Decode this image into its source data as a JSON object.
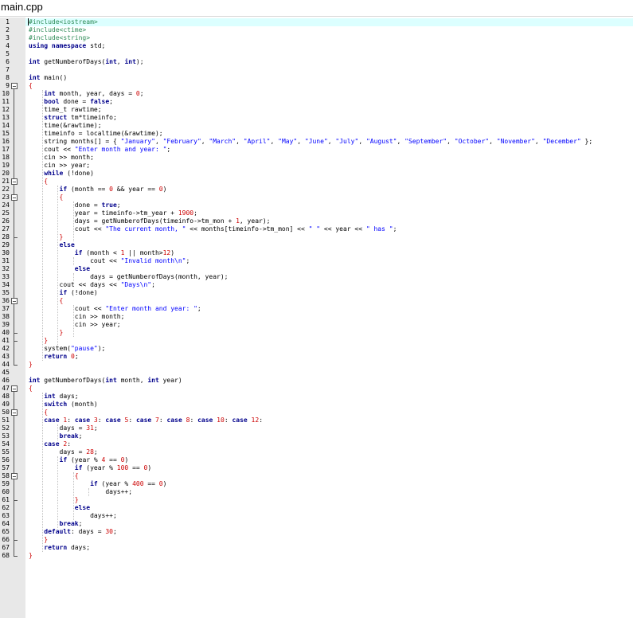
{
  "window": {
    "title": "main.cpp"
  },
  "colors": {
    "keyword": "#00008b",
    "string": "#0000ff",
    "number": "#cc0000",
    "preprocessor": "#2e8b57",
    "brace": "#cc0000",
    "plain": "#000000",
    "current_line": "#dcffff"
  },
  "editor": {
    "current_line": 1,
    "lines": [
      {
        "n": "1",
        "t": [
          [
            "pp",
            "#include<iostream>"
          ]
        ]
      },
      {
        "n": "2",
        "t": [
          [
            "pp",
            "#include<ctime>"
          ]
        ]
      },
      {
        "n": "3",
        "t": [
          [
            "pp",
            "#include<string>"
          ]
        ]
      },
      {
        "n": "4",
        "t": [
          [
            "kw",
            "using namespace"
          ],
          [
            "p",
            " std;"
          ]
        ]
      },
      {
        "n": "5",
        "t": []
      },
      {
        "n": "6",
        "t": [
          [
            "kw",
            "int"
          ],
          [
            "p",
            " getNumberofDays("
          ],
          [
            "kw",
            "int"
          ],
          [
            "p",
            ", "
          ],
          [
            "kw",
            "int"
          ],
          [
            "p",
            ");"
          ]
        ]
      },
      {
        "n": "7",
        "t": []
      },
      {
        "n": "8",
        "t": [
          [
            "kw",
            "int"
          ],
          [
            "p",
            " main()"
          ]
        ]
      },
      {
        "n": "9",
        "t": [
          [
            "br",
            "{"
          ]
        ]
      },
      {
        "n": "10",
        "t": [
          [
            "p",
            "    "
          ],
          [
            "kw",
            "int"
          ],
          [
            "p",
            " month, year, days = "
          ],
          [
            "num",
            "0"
          ],
          [
            "p",
            ";"
          ]
        ]
      },
      {
        "n": "11",
        "t": [
          [
            "p",
            "    "
          ],
          [
            "kw",
            "bool"
          ],
          [
            "p",
            " done = "
          ],
          [
            "kw",
            "false"
          ],
          [
            "p",
            ";"
          ]
        ]
      },
      {
        "n": "12",
        "t": [
          [
            "p",
            "    time_t rawtime;"
          ]
        ]
      },
      {
        "n": "13",
        "t": [
          [
            "p",
            "    "
          ],
          [
            "kw",
            "struct"
          ],
          [
            "p",
            " tm*timeinfo;"
          ]
        ]
      },
      {
        "n": "14",
        "t": [
          [
            "p",
            "    time(&rawtime);"
          ]
        ]
      },
      {
        "n": "15",
        "t": [
          [
            "p",
            "    timeinfo = localtime(&rawtime);"
          ]
        ]
      },
      {
        "n": "16",
        "t": [
          [
            "p",
            "    string months[] = { "
          ],
          [
            "str",
            "\"January\""
          ],
          [
            "p",
            ", "
          ],
          [
            "str",
            "\"February\""
          ],
          [
            "p",
            ", "
          ],
          [
            "str",
            "\"March\""
          ],
          [
            "p",
            ", "
          ],
          [
            "str",
            "\"April\""
          ],
          [
            "p",
            ", "
          ],
          [
            "str",
            "\"May\""
          ],
          [
            "p",
            ", "
          ],
          [
            "str",
            "\"June\""
          ],
          [
            "p",
            ", "
          ],
          [
            "str",
            "\"July\""
          ],
          [
            "p",
            ", "
          ],
          [
            "str",
            "\"August\""
          ],
          [
            "p",
            ", "
          ],
          [
            "str",
            "\"September\""
          ],
          [
            "p",
            ", "
          ],
          [
            "str",
            "\"October\""
          ],
          [
            "p",
            ", "
          ],
          [
            "str",
            "\"November\""
          ],
          [
            "p",
            ", "
          ],
          [
            "str",
            "\"December\""
          ],
          [
            "p",
            " };"
          ]
        ]
      },
      {
        "n": "17",
        "t": [
          [
            "p",
            "    cout << "
          ],
          [
            "str",
            "\"Enter month and year: \""
          ],
          [
            "p",
            ";"
          ]
        ]
      },
      {
        "n": "18",
        "t": [
          [
            "p",
            "    cin >> month;"
          ]
        ]
      },
      {
        "n": "19",
        "t": [
          [
            "p",
            "    cin >> year;"
          ]
        ]
      },
      {
        "n": "20",
        "t": [
          [
            "p",
            "    "
          ],
          [
            "kw",
            "while"
          ],
          [
            "p",
            " (!done)"
          ]
        ]
      },
      {
        "n": "21",
        "t": [
          [
            "p",
            "    "
          ],
          [
            "br",
            "{"
          ]
        ]
      },
      {
        "n": "22",
        "t": [
          [
            "p",
            "        "
          ],
          [
            "kw",
            "if"
          ],
          [
            "p",
            " (month == "
          ],
          [
            "num",
            "0"
          ],
          [
            "p",
            " && year == "
          ],
          [
            "num",
            "0"
          ],
          [
            "p",
            ")"
          ]
        ]
      },
      {
        "n": "23",
        "t": [
          [
            "p",
            "        "
          ],
          [
            "br",
            "{"
          ]
        ]
      },
      {
        "n": "24",
        "t": [
          [
            "p",
            "            done = "
          ],
          [
            "kw",
            "true"
          ],
          [
            "p",
            ";"
          ]
        ]
      },
      {
        "n": "25",
        "t": [
          [
            "p",
            "            year = timeinfo->tm_year + "
          ],
          [
            "num",
            "1900"
          ],
          [
            "p",
            ";"
          ]
        ]
      },
      {
        "n": "26",
        "t": [
          [
            "p",
            "            days = getNumberofDays(timeinfo->tm_mon + "
          ],
          [
            "num",
            "1"
          ],
          [
            "p",
            ", year);"
          ]
        ]
      },
      {
        "n": "27",
        "t": [
          [
            "p",
            "            cout << "
          ],
          [
            "str",
            "\"The current month, \""
          ],
          [
            "p",
            " << months[timeinfo->tm_mon] << "
          ],
          [
            "str",
            "\" \""
          ],
          [
            "p",
            " << year << "
          ],
          [
            "str",
            "\" has \""
          ],
          [
            "p",
            ";"
          ]
        ]
      },
      {
        "n": "28",
        "t": [
          [
            "p",
            "        "
          ],
          [
            "br",
            "}"
          ]
        ]
      },
      {
        "n": "29",
        "t": [
          [
            "p",
            "        "
          ],
          [
            "kw",
            "else"
          ]
        ]
      },
      {
        "n": "30",
        "t": [
          [
            "p",
            "            "
          ],
          [
            "kw",
            "if"
          ],
          [
            "p",
            " (month < "
          ],
          [
            "num",
            "1"
          ],
          [
            "p",
            " || month>"
          ],
          [
            "num",
            "12"
          ],
          [
            "p",
            ")"
          ]
        ]
      },
      {
        "n": "31",
        "t": [
          [
            "p",
            "                cout << "
          ],
          [
            "str",
            "\"Invalid month\\n\""
          ],
          [
            "p",
            ";"
          ]
        ]
      },
      {
        "n": "32",
        "t": [
          [
            "p",
            "            "
          ],
          [
            "kw",
            "else"
          ]
        ]
      },
      {
        "n": "33",
        "t": [
          [
            "p",
            "                days = getNumberofDays(month, year);"
          ]
        ]
      },
      {
        "n": "34",
        "t": [
          [
            "p",
            "        cout << days << "
          ],
          [
            "str",
            "\"Days\\n\""
          ],
          [
            "p",
            ";"
          ]
        ]
      },
      {
        "n": "35",
        "t": [
          [
            "p",
            "        "
          ],
          [
            "kw",
            "if"
          ],
          [
            "p",
            " (!done)"
          ]
        ]
      },
      {
        "n": "36",
        "t": [
          [
            "p",
            "        "
          ],
          [
            "br",
            "{"
          ]
        ]
      },
      {
        "n": "37",
        "t": [
          [
            "p",
            "            cout << "
          ],
          [
            "str",
            "\"Enter month and year: \""
          ],
          [
            "p",
            ";"
          ]
        ]
      },
      {
        "n": "38",
        "t": [
          [
            "p",
            "            cin >> month;"
          ]
        ]
      },
      {
        "n": "39",
        "t": [
          [
            "p",
            "            cin >> year;"
          ]
        ]
      },
      {
        "n": "40",
        "t": [
          [
            "p",
            "        "
          ],
          [
            "br",
            "}"
          ]
        ]
      },
      {
        "n": "41",
        "t": [
          [
            "p",
            "    "
          ],
          [
            "br",
            "}"
          ]
        ]
      },
      {
        "n": "42",
        "t": [
          [
            "p",
            "    system("
          ],
          [
            "str",
            "\"pause\""
          ],
          [
            "p",
            ");"
          ]
        ]
      },
      {
        "n": "43",
        "t": [
          [
            "p",
            "    "
          ],
          [
            "kw",
            "return"
          ],
          [
            "p",
            " "
          ],
          [
            "num",
            "0"
          ],
          [
            "p",
            ";"
          ]
        ]
      },
      {
        "n": "44",
        "t": [
          [
            "br",
            "}"
          ]
        ]
      },
      {
        "n": "45",
        "t": []
      },
      {
        "n": "46",
        "t": [
          [
            "kw",
            "int"
          ],
          [
            "p",
            " getNumberofDays("
          ],
          [
            "kw",
            "int"
          ],
          [
            "p",
            " month, "
          ],
          [
            "kw",
            "int"
          ],
          [
            "p",
            " year)"
          ]
        ]
      },
      {
        "n": "47",
        "t": [
          [
            "br",
            "{"
          ]
        ]
      },
      {
        "n": "48",
        "t": [
          [
            "p",
            "    "
          ],
          [
            "kw",
            "int"
          ],
          [
            "p",
            " days;"
          ]
        ]
      },
      {
        "n": "49",
        "t": [
          [
            "p",
            "    "
          ],
          [
            "kw",
            "switch"
          ],
          [
            "p",
            " (month)"
          ]
        ]
      },
      {
        "n": "50",
        "t": [
          [
            "p",
            "    "
          ],
          [
            "br",
            "{"
          ]
        ]
      },
      {
        "n": "51",
        "t": [
          [
            "p",
            "    "
          ],
          [
            "kw",
            "case"
          ],
          [
            "p",
            " "
          ],
          [
            "num",
            "1"
          ],
          [
            "p",
            ": "
          ],
          [
            "kw",
            "case"
          ],
          [
            "p",
            " "
          ],
          [
            "num",
            "3"
          ],
          [
            "p",
            ": "
          ],
          [
            "kw",
            "case"
          ],
          [
            "p",
            " "
          ],
          [
            "num",
            "5"
          ],
          [
            "p",
            ": "
          ],
          [
            "kw",
            "case"
          ],
          [
            "p",
            " "
          ],
          [
            "num",
            "7"
          ],
          [
            "p",
            ": "
          ],
          [
            "kw",
            "case"
          ],
          [
            "p",
            " "
          ],
          [
            "num",
            "8"
          ],
          [
            "p",
            ": "
          ],
          [
            "kw",
            "case"
          ],
          [
            "p",
            " "
          ],
          [
            "num",
            "10"
          ],
          [
            "p",
            ": "
          ],
          [
            "kw",
            "case"
          ],
          [
            "p",
            " "
          ],
          [
            "num",
            "12"
          ],
          [
            "p",
            ":"
          ]
        ]
      },
      {
        "n": "52",
        "t": [
          [
            "p",
            "        days = "
          ],
          [
            "num",
            "31"
          ],
          [
            "p",
            ";"
          ]
        ]
      },
      {
        "n": "53",
        "t": [
          [
            "p",
            "        "
          ],
          [
            "kw",
            "break"
          ],
          [
            "p",
            ";"
          ]
        ]
      },
      {
        "n": "54",
        "t": [
          [
            "p",
            "    "
          ],
          [
            "kw",
            "case"
          ],
          [
            "p",
            " "
          ],
          [
            "num",
            "2"
          ],
          [
            "p",
            ":"
          ]
        ]
      },
      {
        "n": "55",
        "t": [
          [
            "p",
            "        days = "
          ],
          [
            "num",
            "28"
          ],
          [
            "p",
            ";"
          ]
        ]
      },
      {
        "n": "56",
        "t": [
          [
            "p",
            "        "
          ],
          [
            "kw",
            "if"
          ],
          [
            "p",
            " (year % "
          ],
          [
            "num",
            "4"
          ],
          [
            "p",
            " == "
          ],
          [
            "num",
            "0"
          ],
          [
            "p",
            ")"
          ]
        ]
      },
      {
        "n": "57",
        "t": [
          [
            "p",
            "            "
          ],
          [
            "kw",
            "if"
          ],
          [
            "p",
            " (year % "
          ],
          [
            "num",
            "100"
          ],
          [
            "p",
            " == "
          ],
          [
            "num",
            "0"
          ],
          [
            "p",
            ")"
          ]
        ]
      },
      {
        "n": "58",
        "t": [
          [
            "p",
            "            "
          ],
          [
            "br",
            "{"
          ]
        ]
      },
      {
        "n": "59",
        "t": [
          [
            "p",
            "                "
          ],
          [
            "kw",
            "if"
          ],
          [
            "p",
            " (year % "
          ],
          [
            "num",
            "400"
          ],
          [
            "p",
            " == "
          ],
          [
            "num",
            "0"
          ],
          [
            "p",
            ")"
          ]
        ]
      },
      {
        "n": "60",
        "t": [
          [
            "p",
            "                    days++;"
          ]
        ]
      },
      {
        "n": "61",
        "t": [
          [
            "p",
            "            "
          ],
          [
            "br",
            "}"
          ]
        ]
      },
      {
        "n": "62",
        "t": [
          [
            "p",
            "            "
          ],
          [
            "kw",
            "else"
          ]
        ]
      },
      {
        "n": "63",
        "t": [
          [
            "p",
            "                days++;"
          ]
        ]
      },
      {
        "n": "64",
        "t": [
          [
            "p",
            "        "
          ],
          [
            "kw",
            "break"
          ],
          [
            "p",
            ";"
          ]
        ]
      },
      {
        "n": "65",
        "t": [
          [
            "p",
            "    "
          ],
          [
            "kw",
            "default"
          ],
          [
            "p",
            ": days = "
          ],
          [
            "num",
            "30"
          ],
          [
            "p",
            ";"
          ]
        ]
      },
      {
        "n": "66",
        "t": [
          [
            "p",
            "    "
          ],
          [
            "br",
            "}"
          ]
        ]
      },
      {
        "n": "67",
        "t": [
          [
            "p",
            "    "
          ],
          [
            "kw",
            "return"
          ],
          [
            "p",
            " days;"
          ]
        ]
      },
      {
        "n": "68",
        "t": [
          [
            "br",
            "}"
          ]
        ]
      }
    ]
  }
}
